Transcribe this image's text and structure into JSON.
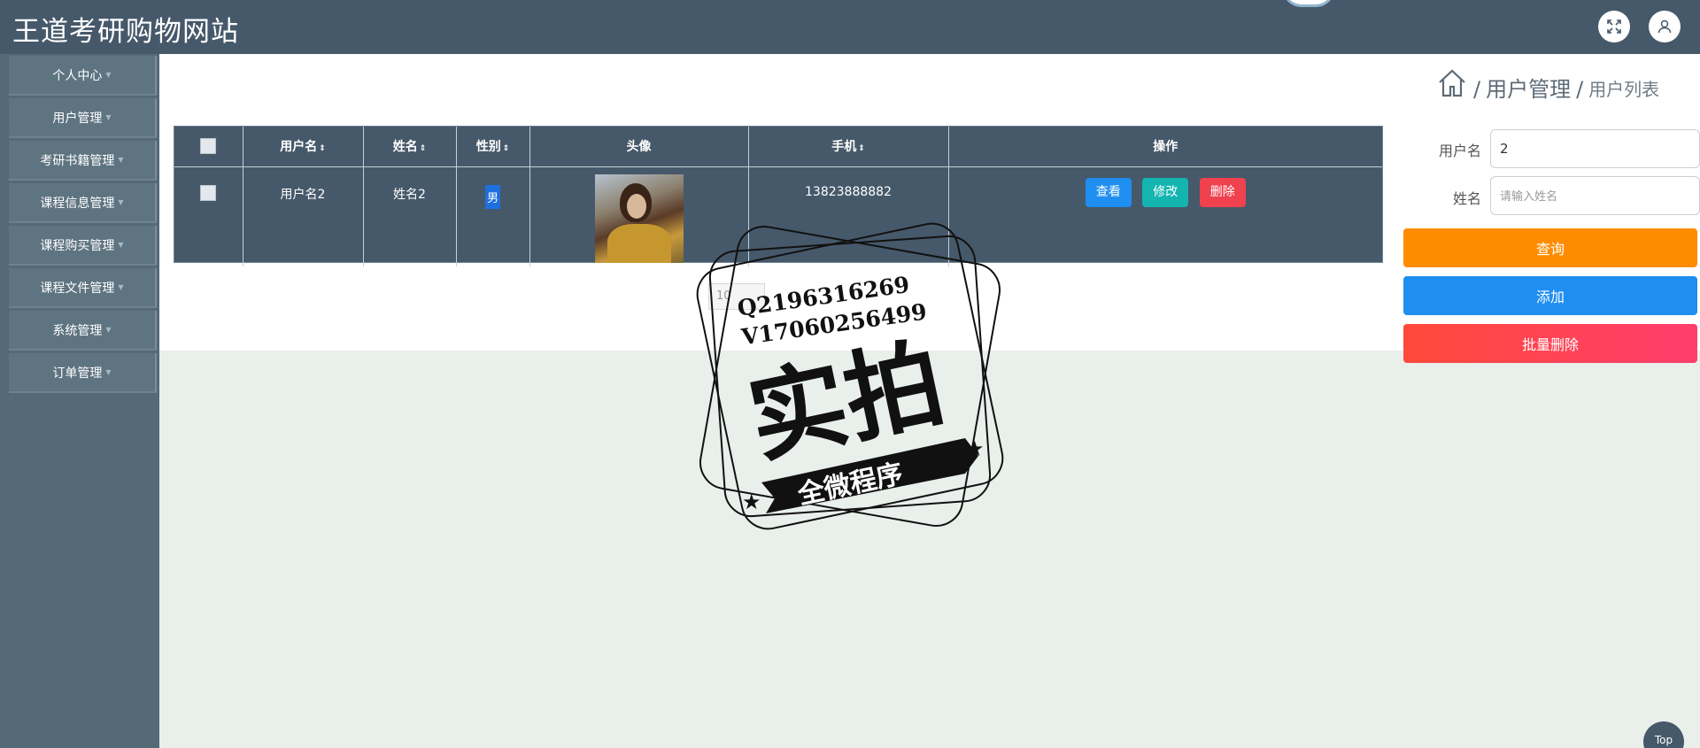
{
  "app": {
    "title": "王道考研购物网站"
  },
  "header": {
    "fullscreen_icon": "expand-icon",
    "user_icon": "user-icon"
  },
  "sidebar": {
    "items": [
      {
        "label": "个人中心"
      },
      {
        "label": "用户管理"
      },
      {
        "label": "考研书籍管理"
      },
      {
        "label": "课程信息管理"
      },
      {
        "label": "课程购买管理"
      },
      {
        "label": "课程文件管理"
      },
      {
        "label": "系统管理"
      },
      {
        "label": "订单管理"
      }
    ]
  },
  "table": {
    "columns": [
      "用户名",
      "姓名",
      "性别",
      "头像",
      "手机",
      "操作"
    ],
    "rows": [
      {
        "username": "用户名2",
        "name": "姓名2",
        "gender": "男",
        "phone": "13823888882"
      }
    ],
    "actions": {
      "view": "查看",
      "edit": "修改",
      "delete": "删除"
    }
  },
  "pager": {
    "page_size": "10"
  },
  "breadcrumb": {
    "level1": "用户管理",
    "level2": "用户列表"
  },
  "search": {
    "username_label": "用户名",
    "username_value": "2",
    "name_label": "姓名",
    "name_placeholder": "请输入姓名"
  },
  "buttons": {
    "query": "查询",
    "add": "添加",
    "batch_delete": "批量删除"
  },
  "back_to_top": "Top",
  "watermark": {
    "line1": "Q2196316269",
    "line2": "V17060256499",
    "main": "实拍",
    "banner": "全微程序"
  },
  "colors": {
    "header": "#46596a",
    "sidebar": "#556a76",
    "query": "#ff8c00",
    "add": "#1f8ef1",
    "delete": "#f0414e",
    "edit": "#14b5b0"
  }
}
